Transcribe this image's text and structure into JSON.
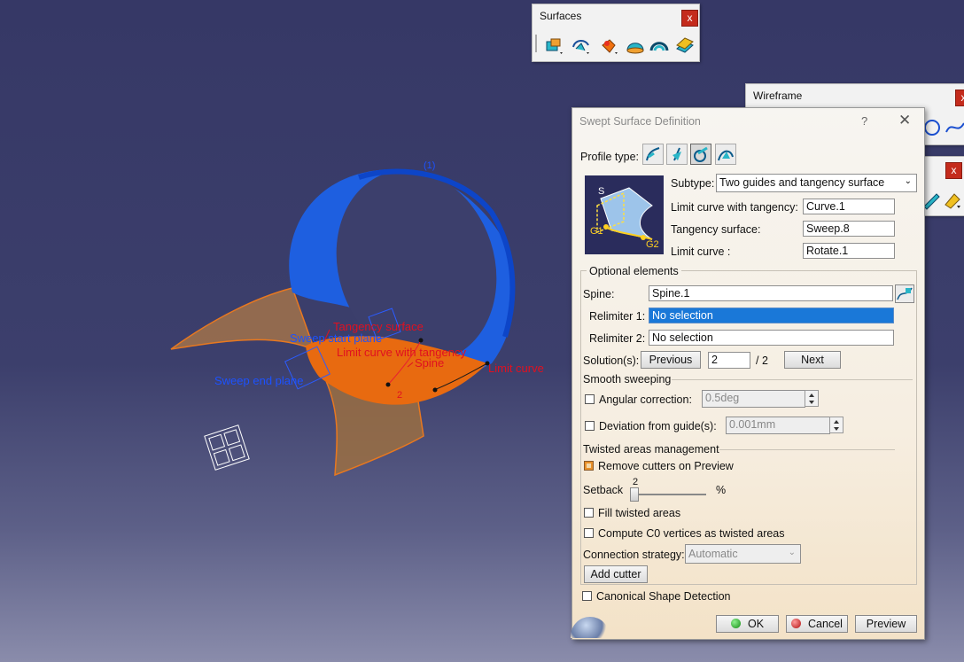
{
  "viewport": {
    "labels": {
      "tangency_surface": "Tangency surface",
      "sweep_start_plane": "Sweep start plane",
      "limit_curve_with_tangency": "Limit curve with tangency",
      "spine": "Spine",
      "limit_curve": "Limit curve",
      "sweep_end_plane": "Sweep end plane",
      "marker_1": "(1)",
      "marker_2": "2"
    },
    "colors": {
      "tube": "#1f63e6",
      "sweep": "#e36a10",
      "tangent_surface": "#b07a45",
      "annotation_red": "#e01020",
      "annotation_blue": "#1c52ff"
    }
  },
  "toolbars": {
    "surfaces": {
      "title": "Surfaces",
      "close": "x",
      "icons": [
        "extrude-icon",
        "revolve-icon",
        "sphere-icon",
        "cylinder-icon",
        "offset-icon",
        "sweep-icon"
      ]
    },
    "wireframe": {
      "title": "Wireframe",
      "close": "x",
      "icons": [
        "circle-icon",
        "spline-icon"
      ]
    },
    "third": {
      "close": "x",
      "icons": [
        "edit-icon",
        "paint-icon"
      ]
    }
  },
  "dialog": {
    "title": "Swept Surface Definition",
    "help": "?",
    "close": "✕",
    "profile_type_label": "Profile type:",
    "profile_types": [
      "explicit-profile-icon",
      "line-profile-icon",
      "circle-profile-icon",
      "conic-profile-icon"
    ],
    "subtype_label": "Subtype:",
    "subtype_value": "Two guides and tangency surface",
    "preview_labels": {
      "s": "S",
      "g1": "G1",
      "g2": "G2"
    },
    "limit_curve_tangency_label": "Limit curve with tangency:",
    "limit_curve_tangency_value": "Curve.1",
    "tangency_surface_label": "Tangency surface:",
    "tangency_surface_value": "Sweep.8",
    "limit_curve_label": "Limit curve :",
    "limit_curve_value": "Rotate.1",
    "optional_elements": "Optional elements",
    "spine_label": "Spine:",
    "spine_value": "Spine.1",
    "relimiter1_label": "Relimiter 1:",
    "relimiter1_value": "No selection",
    "relimiter2_label": "Relimiter 2:",
    "relimiter2_value": "No selection",
    "solutions_label": "Solution(s):",
    "previous": "Previous",
    "solution_value": "2",
    "solution_total": "/ 2",
    "next": "Next",
    "smooth_sweeping": "Smooth sweeping",
    "angular_correction_label": "Angular correction:",
    "angular_correction_value": "0.5deg",
    "deviation_label": "Deviation from guide(s):",
    "deviation_value": "0.001mm",
    "twisted_areas": "Twisted areas management",
    "remove_cutters": "Remove cutters on Preview",
    "setback_label": "Setback",
    "setback_value": "2",
    "setback_unit": "%",
    "fill_twisted": "Fill twisted areas",
    "compute_c0": "Compute C0 vertices as twisted areas",
    "connection_label": "Connection strategy:",
    "connection_value": "Automatic",
    "add_cutter": "Add cutter",
    "canonical": "Canonical Shape Detection",
    "ok": "OK",
    "cancel": "Cancel",
    "preview": "Preview"
  }
}
